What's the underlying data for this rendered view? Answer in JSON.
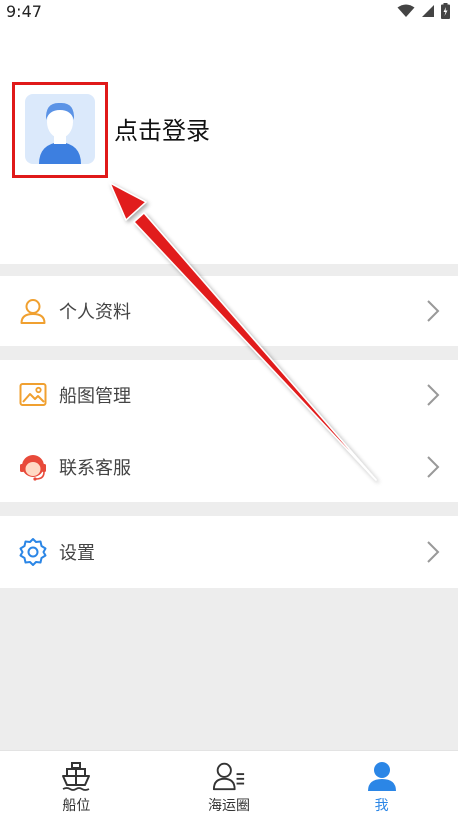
{
  "status_bar": {
    "time": "9:47"
  },
  "profile": {
    "login_label": "点击登录"
  },
  "menu": {
    "personal_info": "个人资料",
    "chart_management": "船图管理",
    "customer_service": "联系客服",
    "settings": "设置"
  },
  "tabs": [
    {
      "label": "船位",
      "icon": "ship-icon",
      "active": false
    },
    {
      "label": "海运圈",
      "icon": "community-icon",
      "active": false
    },
    {
      "label": "我",
      "icon": "user-icon",
      "active": true
    }
  ],
  "colors": {
    "accent_blue": "#2b86e6",
    "orange_icon": "#f0a030",
    "service_red": "#e84a3a",
    "highlight_red": "#e01919",
    "divider_gray": "#ededed"
  }
}
